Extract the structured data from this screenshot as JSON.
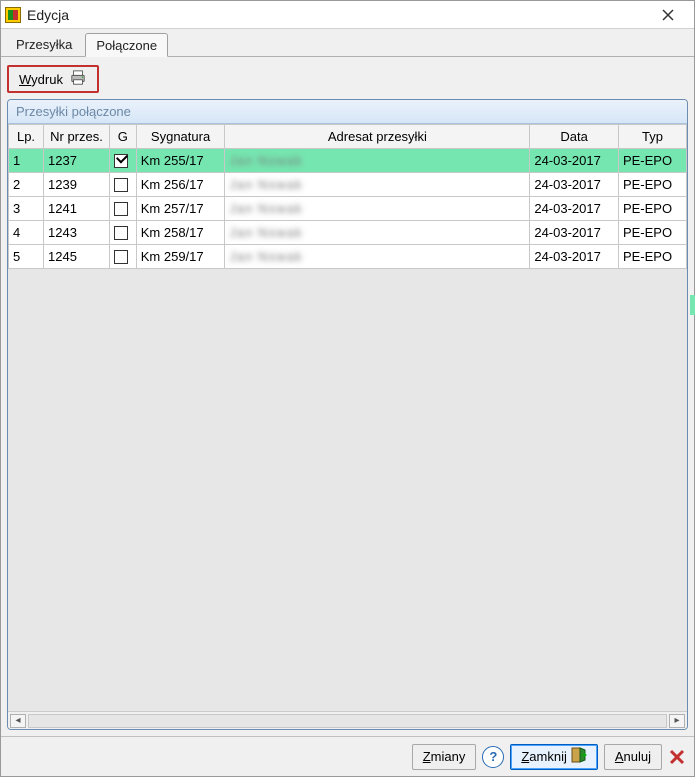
{
  "window": {
    "title": "Edycja"
  },
  "tabs": [
    {
      "label": "Przesyłka",
      "active": false
    },
    {
      "label": "Połączone",
      "active": true
    }
  ],
  "toolbar": {
    "print_label": "Wydruk"
  },
  "panel": {
    "title": "Przesyłki połączone"
  },
  "grid": {
    "columns": {
      "lp": "Lp.",
      "nr": "Nr przes.",
      "g": "G",
      "sygnatura": "Sygnatura",
      "adresat": "Adresat przesyłki",
      "data": "Data",
      "typ": "Typ"
    },
    "rows": [
      {
        "lp": "1",
        "nr": "1237",
        "g": true,
        "sygnatura": "Km 255/17",
        "adresat": "Jan Nowak",
        "data": "24-03-2017",
        "typ": "PE-EPO",
        "selected": true
      },
      {
        "lp": "2",
        "nr": "1239",
        "g": false,
        "sygnatura": "Km 256/17",
        "adresat": "Jan Nowak",
        "data": "24-03-2017",
        "typ": "PE-EPO",
        "selected": false
      },
      {
        "lp": "3",
        "nr": "1241",
        "g": false,
        "sygnatura": "Km 257/17",
        "adresat": "Jan Nowak",
        "data": "24-03-2017",
        "typ": "PE-EPO",
        "selected": false
      },
      {
        "lp": "4",
        "nr": "1243",
        "g": false,
        "sygnatura": "Km 258/17",
        "adresat": "Jan Nowak",
        "data": "24-03-2017",
        "typ": "PE-EPO",
        "selected": false
      },
      {
        "lp": "5",
        "nr": "1245",
        "g": false,
        "sygnatura": "Km 259/17",
        "adresat": "Jan Nowak",
        "data": "24-03-2017",
        "typ": "PE-EPO",
        "selected": false
      }
    ]
  },
  "buttons": {
    "zmiany": "Zmiany",
    "zamknij": "Zamknij",
    "anuluj": "Anuluj"
  }
}
